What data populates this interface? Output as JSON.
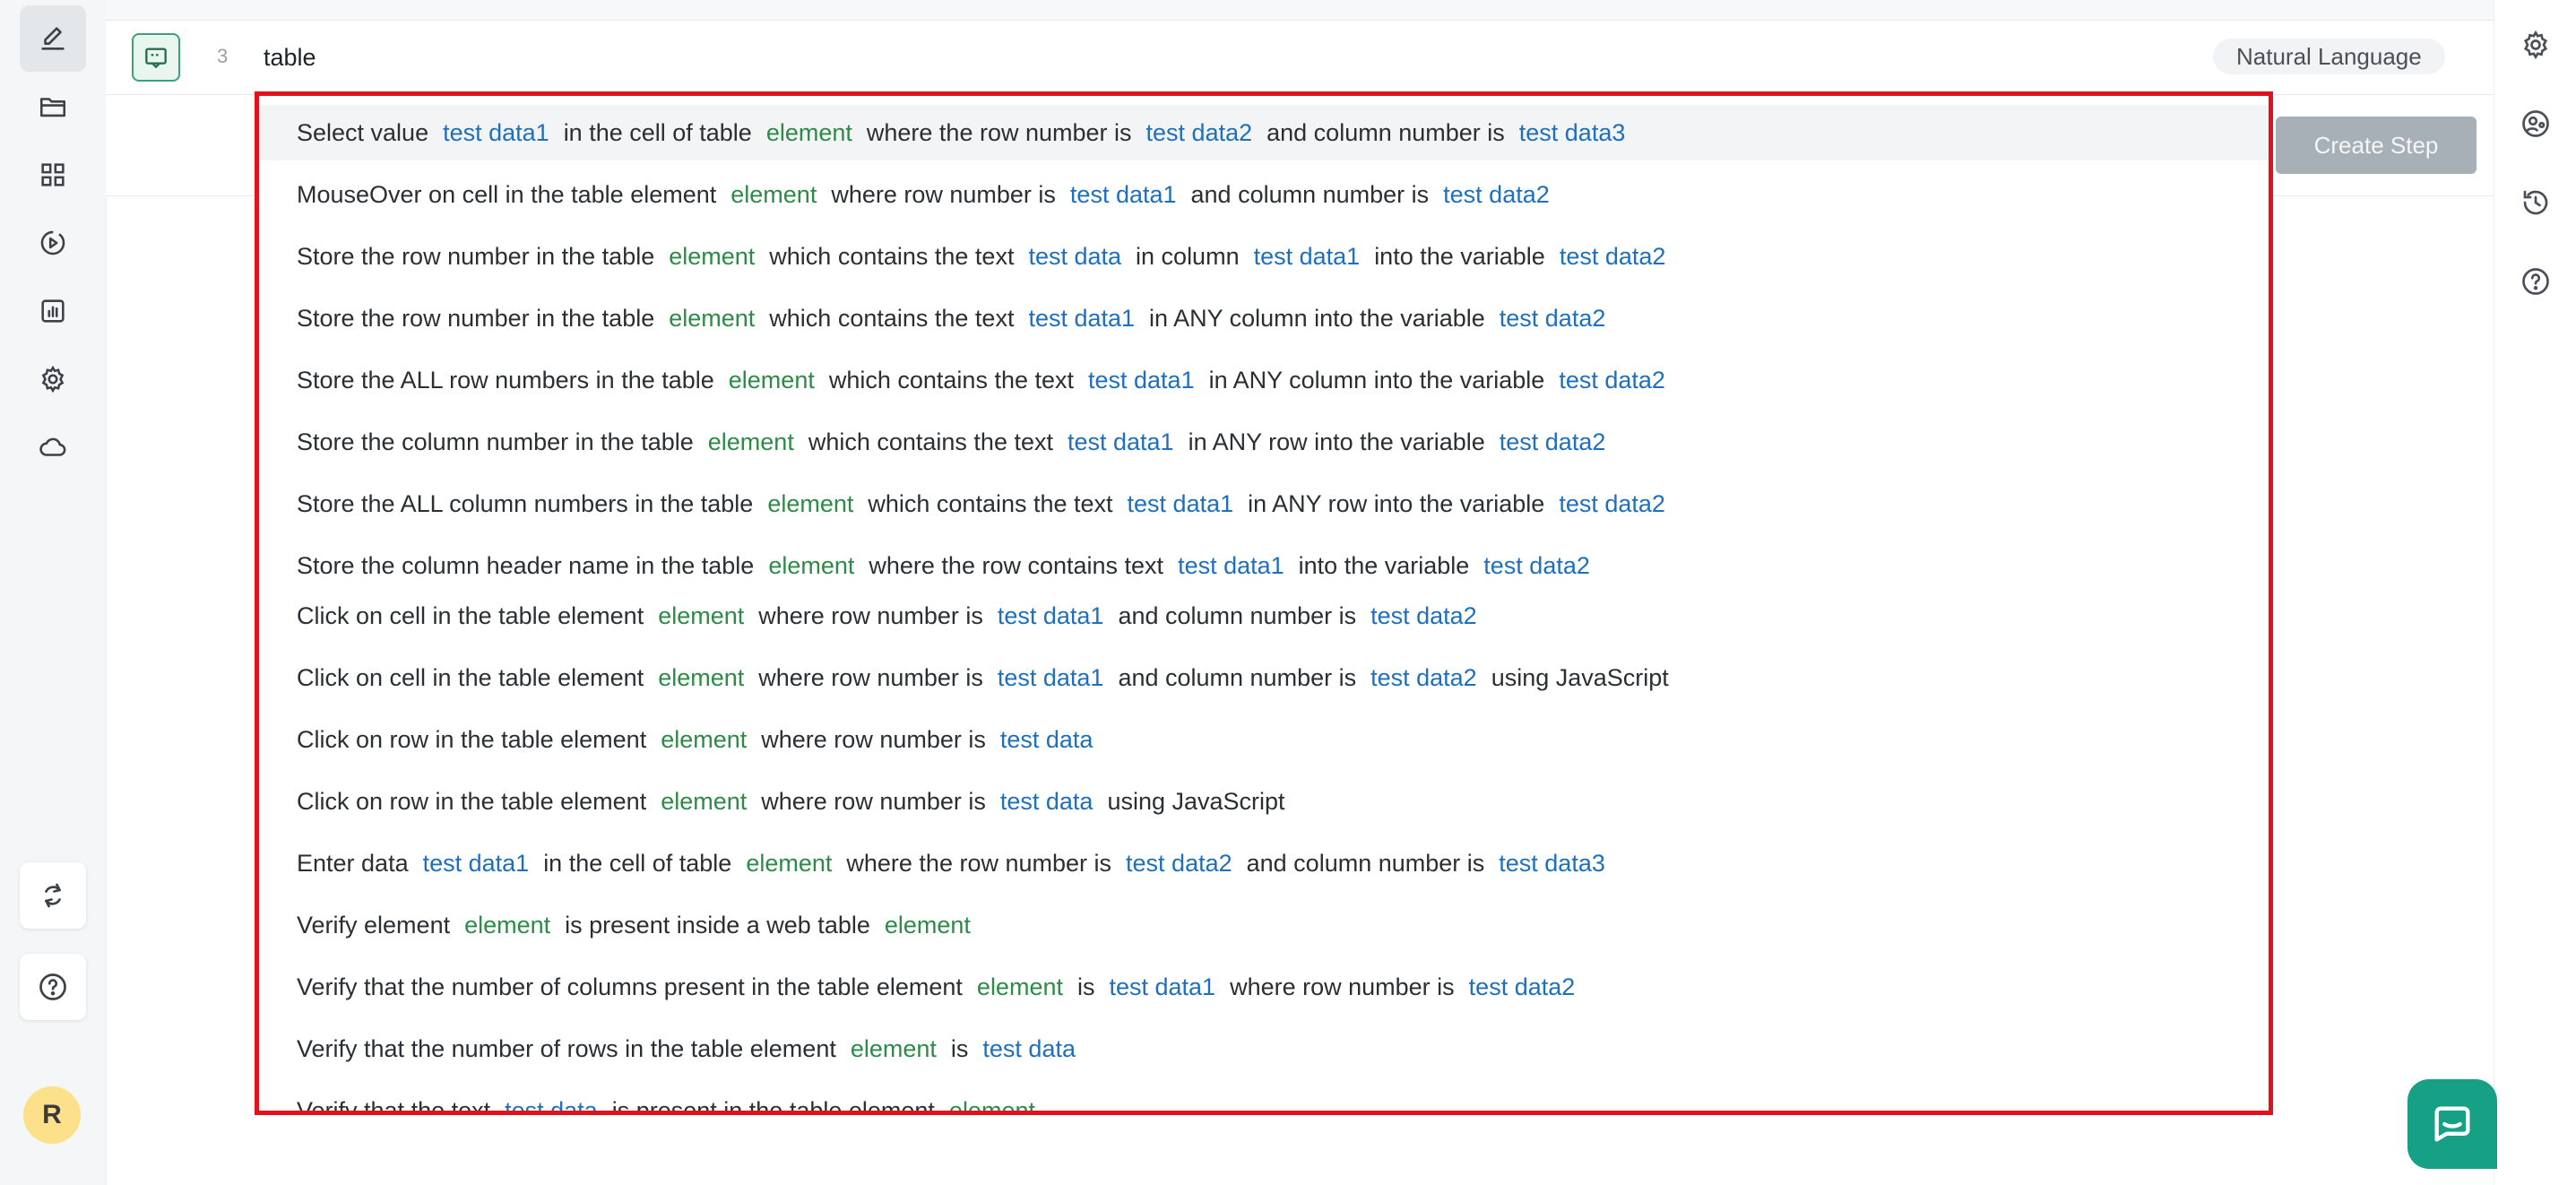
{
  "editor": {
    "line_number": "3",
    "input_value": "table",
    "language_badge": "Natural Language",
    "create_step_label": "Create Step"
  },
  "sidebar": {
    "items": [
      {
        "name": "edit-icon"
      },
      {
        "name": "folder-icon"
      },
      {
        "name": "dashboard-icon"
      },
      {
        "name": "run-icon"
      },
      {
        "name": "reports-icon"
      },
      {
        "name": "settings-icon"
      },
      {
        "name": "cloud-icon"
      }
    ],
    "bottom": [
      {
        "name": "sync-icon"
      },
      {
        "name": "help-icon"
      }
    ],
    "avatar_initial": "R"
  },
  "right_rail": {
    "items": [
      {
        "name": "settings-icon"
      },
      {
        "name": "user-settings-icon"
      },
      {
        "name": "history-icon"
      },
      {
        "name": "help-icon"
      }
    ]
  },
  "suggestions": [
    [
      {
        "t": "Select value",
        "k": "text"
      },
      {
        "t": "test data1",
        "k": "data"
      },
      {
        "t": "in the cell of table",
        "k": "text"
      },
      {
        "t": "element",
        "k": "element"
      },
      {
        "t": "where the row number is",
        "k": "text"
      },
      {
        "t": "test data2",
        "k": "data"
      },
      {
        "t": "and column number is",
        "k": "text"
      },
      {
        "t": "test data3",
        "k": "data"
      }
    ],
    [
      {
        "t": "MouseOver on cell in the table element",
        "k": "text"
      },
      {
        "t": "element",
        "k": "element"
      },
      {
        "t": "where row number is",
        "k": "text"
      },
      {
        "t": "test data1",
        "k": "data"
      },
      {
        "t": "and column number is",
        "k": "text"
      },
      {
        "t": "test data2",
        "k": "data"
      }
    ],
    [
      {
        "t": "Store the row number in the table",
        "k": "text"
      },
      {
        "t": "element",
        "k": "element"
      },
      {
        "t": "which contains the text",
        "k": "text"
      },
      {
        "t": "test data",
        "k": "data"
      },
      {
        "t": "in column",
        "k": "text"
      },
      {
        "t": "test data1",
        "k": "data"
      },
      {
        "t": "into the variable",
        "k": "text"
      },
      {
        "t": "test data2",
        "k": "data"
      }
    ],
    [
      {
        "t": "Store the row number in the table",
        "k": "text"
      },
      {
        "t": "element",
        "k": "element"
      },
      {
        "t": "which contains the text",
        "k": "text"
      },
      {
        "t": "test data1",
        "k": "data"
      },
      {
        "t": "in ANY column into the variable",
        "k": "text"
      },
      {
        "t": "test data2",
        "k": "data"
      }
    ],
    [
      {
        "t": "Store the ALL row numbers in the table",
        "k": "text"
      },
      {
        "t": "element",
        "k": "element"
      },
      {
        "t": "which contains the text",
        "k": "text"
      },
      {
        "t": "test data1",
        "k": "data"
      },
      {
        "t": "in ANY column into the variable",
        "k": "text"
      },
      {
        "t": "test data2",
        "k": "data"
      }
    ],
    [
      {
        "t": "Store the column number in the table",
        "k": "text"
      },
      {
        "t": "element",
        "k": "element"
      },
      {
        "t": "which contains the text",
        "k": "text"
      },
      {
        "t": "test data1",
        "k": "data"
      },
      {
        "t": "in ANY row into the variable",
        "k": "text"
      },
      {
        "t": "test data2",
        "k": "data"
      }
    ],
    [
      {
        "t": "Store the ALL column numbers in the table",
        "k": "text"
      },
      {
        "t": "element",
        "k": "element"
      },
      {
        "t": "which contains the text",
        "k": "text"
      },
      {
        "t": "test data1",
        "k": "data"
      },
      {
        "t": "in ANY row into the variable",
        "k": "text"
      },
      {
        "t": "test data2",
        "k": "data"
      }
    ],
    [
      {
        "t": "Store the column header name in the table",
        "k": "text"
      },
      {
        "t": "element",
        "k": "element"
      },
      {
        "t": "where the row contains text",
        "k": "text"
      },
      {
        "t": "test data1",
        "k": "data"
      },
      {
        "t": "into the variable",
        "k": "text"
      },
      {
        "t": "test data2",
        "k": "data"
      }
    ],
    [
      {
        "t": "Click on cell in the table element",
        "k": "text"
      },
      {
        "t": "element",
        "k": "element"
      },
      {
        "t": "where row number is",
        "k": "text"
      },
      {
        "t": "test data1",
        "k": "data"
      },
      {
        "t": "and column number is",
        "k": "text"
      },
      {
        "t": "test data2",
        "k": "data"
      }
    ],
    [
      {
        "t": "Click on cell in the table element",
        "k": "text"
      },
      {
        "t": "element",
        "k": "element"
      },
      {
        "t": "where row number is",
        "k": "text"
      },
      {
        "t": "test data1",
        "k": "data"
      },
      {
        "t": "and column number is",
        "k": "text"
      },
      {
        "t": "test data2",
        "k": "data"
      },
      {
        "t": "using JavaScript",
        "k": "text"
      }
    ],
    [
      {
        "t": "Click on row in the table element",
        "k": "text"
      },
      {
        "t": "element",
        "k": "element"
      },
      {
        "t": "where row number is",
        "k": "text"
      },
      {
        "t": "test data",
        "k": "data"
      }
    ],
    [
      {
        "t": "Click on row in the table element",
        "k": "text"
      },
      {
        "t": "element",
        "k": "element"
      },
      {
        "t": "where row number is",
        "k": "text"
      },
      {
        "t": "test data",
        "k": "data"
      },
      {
        "t": "using JavaScript",
        "k": "text"
      }
    ],
    [
      {
        "t": "Enter data",
        "k": "text"
      },
      {
        "t": "test data1",
        "k": "data"
      },
      {
        "t": "in the cell of table",
        "k": "text"
      },
      {
        "t": "element",
        "k": "element"
      },
      {
        "t": "where the row number is",
        "k": "text"
      },
      {
        "t": "test data2",
        "k": "data"
      },
      {
        "t": "and column number is",
        "k": "text"
      },
      {
        "t": "test data3",
        "k": "data"
      }
    ],
    [
      {
        "t": "Verify element",
        "k": "text"
      },
      {
        "t": "element",
        "k": "element"
      },
      {
        "t": "is present inside a web table",
        "k": "text"
      },
      {
        "t": "element",
        "k": "element"
      }
    ],
    [
      {
        "t": "Verify that the number of columns present in the table element",
        "k": "text"
      },
      {
        "t": "element",
        "k": "element"
      },
      {
        "t": "is",
        "k": "text"
      },
      {
        "t": "test data1",
        "k": "data"
      },
      {
        "t": "where row number is",
        "k": "text"
      },
      {
        "t": "test data2",
        "k": "data"
      }
    ],
    [
      {
        "t": "Verify that the number of rows in the table element",
        "k": "text"
      },
      {
        "t": "element",
        "k": "element"
      },
      {
        "t": "is",
        "k": "text"
      },
      {
        "t": "test data",
        "k": "data"
      }
    ],
    [
      {
        "t": "Verify that the text",
        "k": "text"
      },
      {
        "t": "test data",
        "k": "data"
      },
      {
        "t": "is present in the table element",
        "k": "text"
      },
      {
        "t": "element",
        "k": "element"
      }
    ]
  ],
  "colors": {
    "element_token": "#2e8a47",
    "data_token": "#1e6fbd",
    "highlight_border": "#e0121b",
    "accent_green": "#3aa376",
    "chat_fab": "#16a085"
  }
}
